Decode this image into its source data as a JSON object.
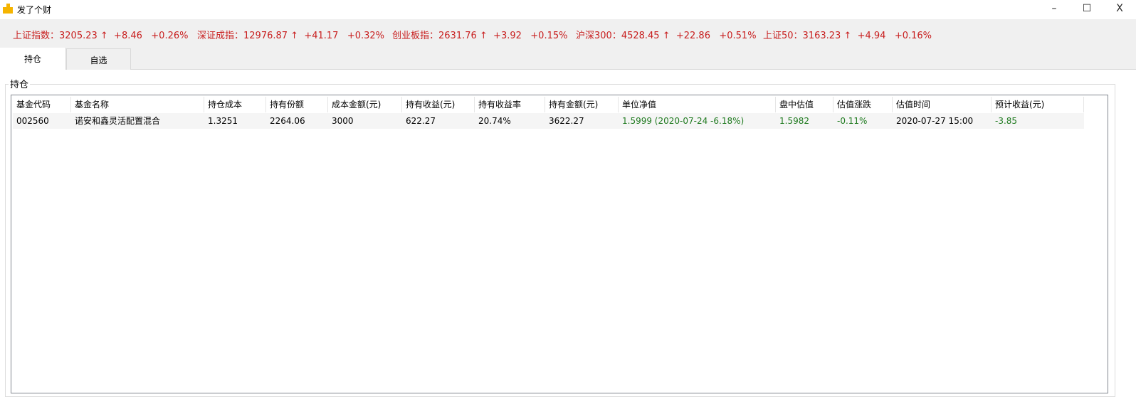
{
  "window": {
    "title": "发了个财",
    "minimize": "–",
    "maximize": "☐",
    "close": "X"
  },
  "colors": {
    "up": "#c81e1e",
    "down": "#1f7a1f"
  },
  "ticker": [
    "上证指数：3205.23 ↑  +8.46   +0.26%",
    "深证成指：12976.87 ↑  +41.17   +0.32%",
    "创业板指：2631.76 ↑  +3.92   +0.15%",
    "沪深300：4528.45 ↑  +22.86   +0.51%",
    "上证50：3163.23 ↑  +4.94   +0.16%"
  ],
  "tabs": [
    {
      "label": "持仓"
    },
    {
      "label": "自选"
    }
  ],
  "group_label": "持仓",
  "table": {
    "columns": [
      "基金代码",
      "基金名称",
      "持仓成本",
      "持有份额",
      "成本金额(元)",
      "持有收益(元)",
      "持有收益率",
      "持有金额(元)",
      "单位净值",
      "盘中估值",
      "估值涨跌",
      "估值时间",
      "预计收益(元)"
    ],
    "rows": [
      [
        "002560",
        "诺安和鑫灵活配置混合",
        "1.3251",
        "2264.06",
        "3000",
        "622.27",
        "20.74%",
        "3622.27",
        "1.5999 (2020-07-24  -6.18%)",
        "1.5982",
        "-0.11%",
        "2020-07-27 15:00",
        "-3.85"
      ]
    ]
  }
}
